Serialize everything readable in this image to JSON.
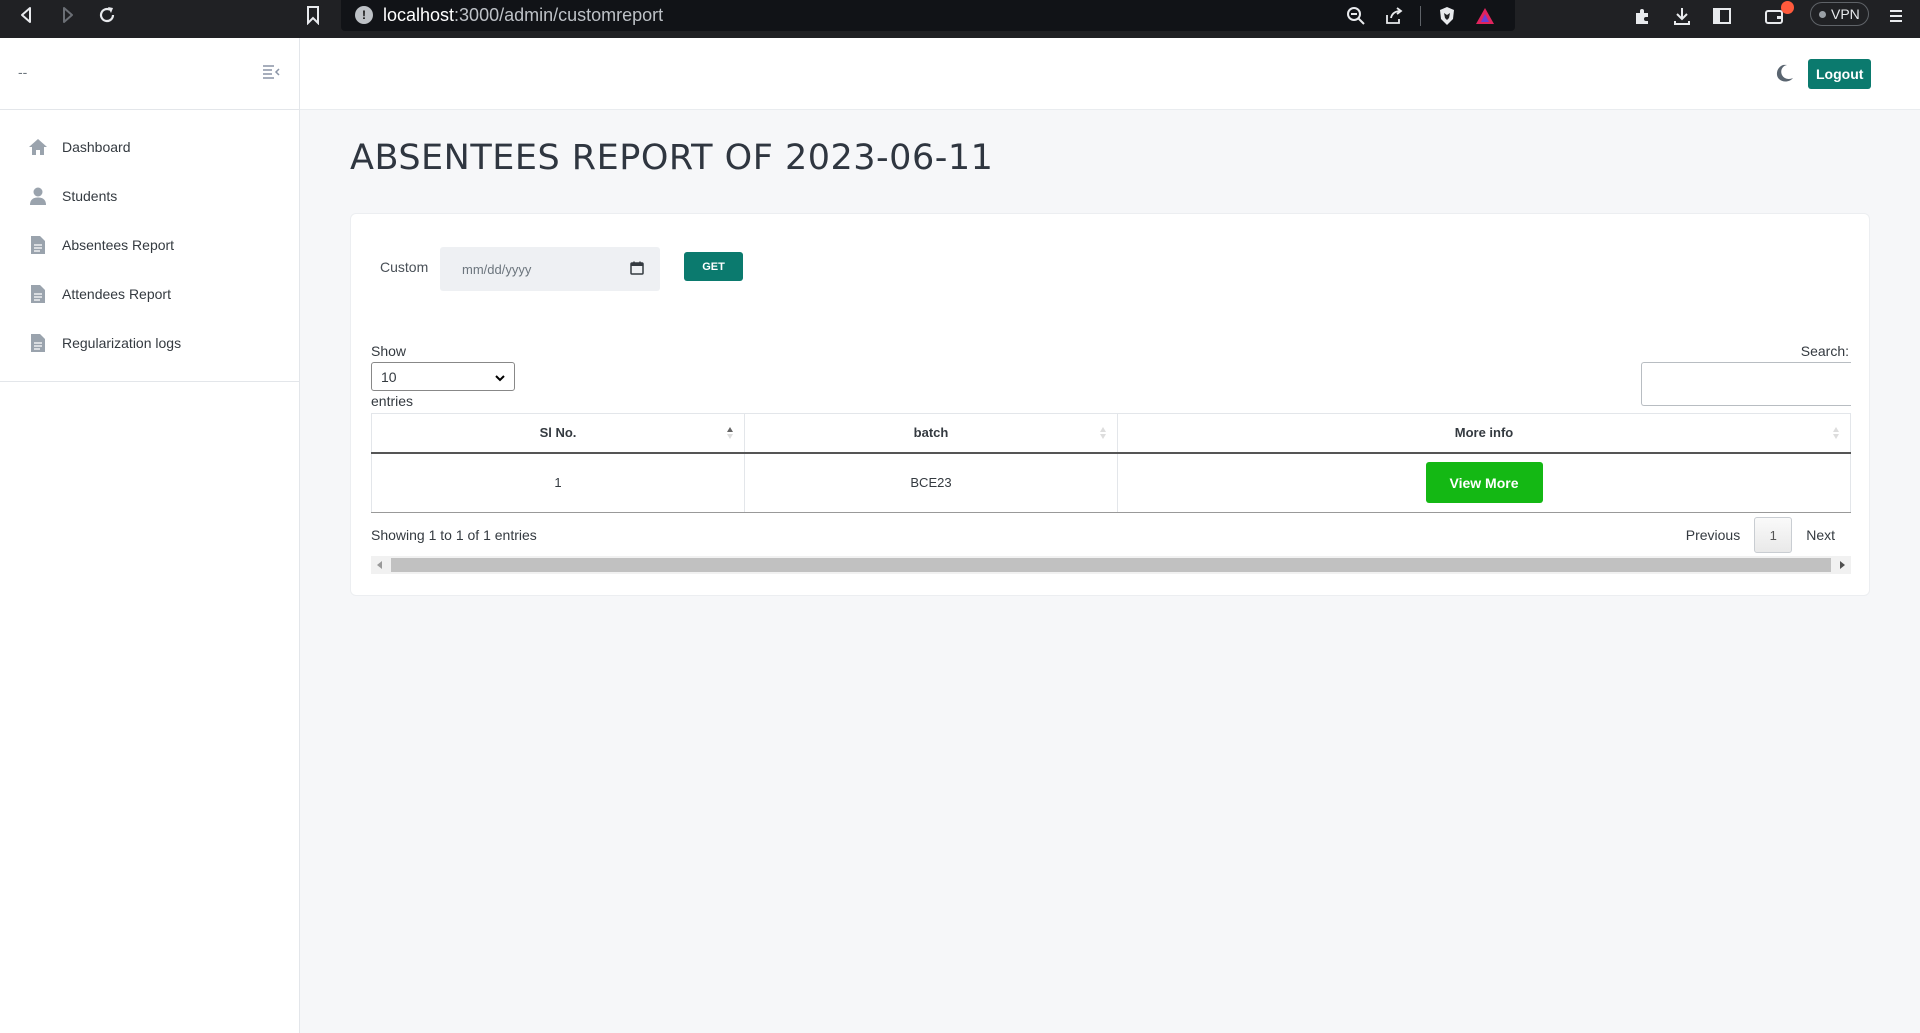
{
  "browser": {
    "url_host": "localhost",
    "url_path": ":3000/admin/customreport",
    "vpn_label": "VPN"
  },
  "sidebar": {
    "brand": "--",
    "items": [
      {
        "label": "Dashboard",
        "icon": "home-icon"
      },
      {
        "label": "Students",
        "icon": "user-icon"
      },
      {
        "label": "Absentees Report",
        "icon": "document-icon"
      },
      {
        "label": "Attendees Report",
        "icon": "document-icon"
      },
      {
        "label": "Regularization logs",
        "icon": "document-icon"
      }
    ]
  },
  "header": {
    "logout_label": "Logout",
    "theme_icon": "moon-icon"
  },
  "page": {
    "title": "ABSENTEES REPORT OF 2023-06-11"
  },
  "filter": {
    "custom_label": "Custom",
    "date_placeholder": "mm/dd/yyyy",
    "get_label": "GET"
  },
  "table_controls": {
    "show_label": "Show",
    "page_size": "10",
    "entries_label": "entries",
    "search_label": "Search:"
  },
  "table": {
    "columns": [
      "Sl No.",
      "batch",
      "More info"
    ],
    "rows": [
      {
        "sl_no": "1",
        "batch": "BCE23",
        "action_label": "View More"
      }
    ]
  },
  "pagination": {
    "info": "Showing 1 to 1 of 1 entries",
    "previous": "Previous",
    "current": "1",
    "next": "Next"
  },
  "colors": {
    "accent": "#0b7a6e",
    "view_button": "#14b814"
  }
}
